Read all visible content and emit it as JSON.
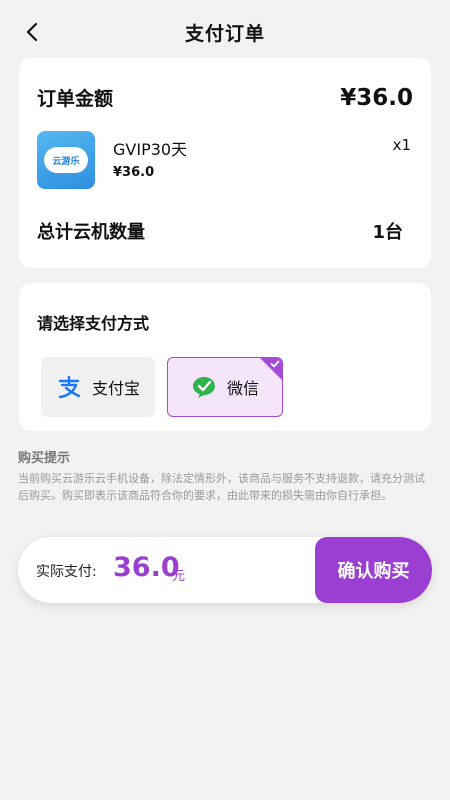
{
  "header": {
    "title": "支付订单",
    "back_icon": "chevron-left-icon"
  },
  "order": {
    "amount_label": "订单金额",
    "amount_value": "¥36.0",
    "product": {
      "icon": "yunyoule-app-icon",
      "icon_text": "云游乐",
      "name": "GVIP30天",
      "price": "¥36.0",
      "quantity": "x1"
    },
    "cloud_label": "总计云机数量",
    "cloud_count": "1台"
  },
  "payment": {
    "title": "请选择支付方式",
    "options": [
      {
        "label": "支付宝",
        "icon": "alipay-icon",
        "selected": false
      },
      {
        "label": "微信",
        "icon": "wechat-pay-icon",
        "selected": true
      }
    ],
    "accent_color": "#9b3fd2"
  },
  "tips": {
    "title": "购买提示",
    "text": "当前购买云游乐云手机设备，除法定情形外，该商品与服务不支持退款，请充分测试后购买。购买即表示该商品符合你的要求，由此带来的损失需由你自行承担。"
  },
  "footer": {
    "pay_label": "实际支付:",
    "pay_amount": "36.0",
    "pay_unit": "元",
    "confirm_label": "确认购买"
  }
}
